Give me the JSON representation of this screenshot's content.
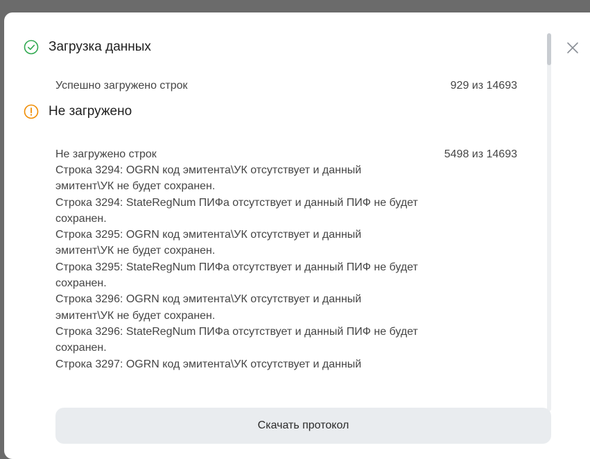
{
  "dialog": {
    "success": {
      "title": "Загрузка данных",
      "label": "Успешно загружено строк",
      "count": "929 из 14693"
    },
    "warning": {
      "title": "Не загружено",
      "label": "Не загружено строк",
      "count": "5498 из 14693",
      "lines": [
        "Строка 3294: OGRN код эмитента\\УК отсутствует и данный",
        "эмитент\\УК не будет сохранен.",
        "Строка 3294: StateRegNum ПИФа отсутствует и данный ПИФ не будет",
        "сохранен.",
        "Строка 3295: OGRN код эмитента\\УК отсутствует и данный",
        "эмитент\\УК не будет сохранен.",
        "Строка 3295: StateRegNum ПИФа отсутствует и данный ПИФ не будет",
        "сохранен.",
        "Строка 3296: OGRN код эмитента\\УК отсутствует и данный",
        "эмитент\\УК не будет сохранен.",
        "Строка 3296: StateRegNum ПИФа отсутствует и данный ПИФ не будет",
        "сохранен.",
        "Строка 3297: OGRN код эмитента\\УК отсутствует и данный"
      ]
    },
    "download_label": "Скачать протокол",
    "icons": {
      "success": "check-circle-icon",
      "warning": "exclamation-circle-icon",
      "close": "close-icon"
    },
    "colors": {
      "success": "#2fa84f",
      "warning": "#f08c00"
    }
  }
}
